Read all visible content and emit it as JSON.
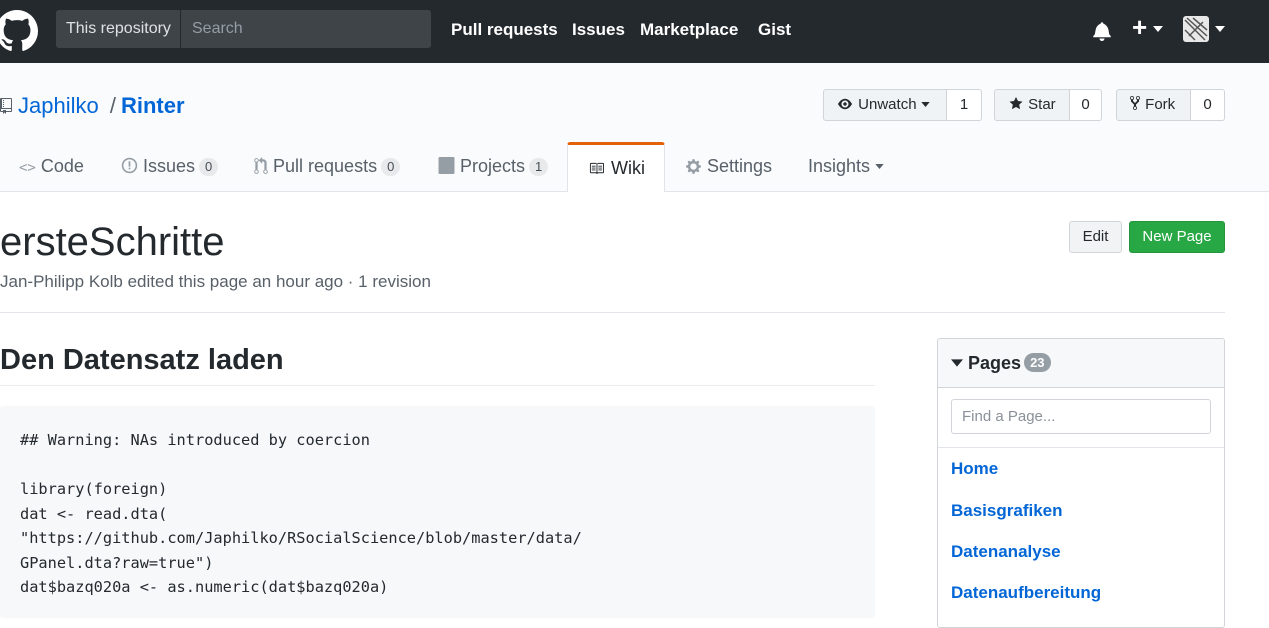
{
  "header": {
    "search_scope": "This repository",
    "search_placeholder": "Search",
    "nav": [
      "Pull requests",
      "Issues",
      "Marketplace",
      "Gist"
    ],
    "plus_label": "+"
  },
  "repo": {
    "owner": "Japhilko",
    "separator": "/",
    "name": "Rinter",
    "watch_label": "Unwatch",
    "watch_count": "1",
    "star_label": "Star",
    "star_count": "0",
    "fork_label": "Fork",
    "fork_count": "0"
  },
  "tabs": [
    {
      "label": "Code",
      "count": null
    },
    {
      "label": "Issues",
      "count": "0"
    },
    {
      "label": "Pull requests",
      "count": "0"
    },
    {
      "label": "Projects",
      "count": "1"
    },
    {
      "label": "Wiki",
      "count": null
    },
    {
      "label": "Settings",
      "count": null
    },
    {
      "label": "Insights",
      "count": null
    }
  ],
  "wiki": {
    "title": "ersteSchritte",
    "meta": "Jan-Philipp Kolb edited this page an hour ago · 1 revision",
    "edit_label": "Edit",
    "new_page_label": "New Page",
    "heading": "Den Datensatz laden",
    "code": "## Warning: NAs introduced by coercion\n\nlibrary(foreign)\ndat <- read.dta(\n\"https://github.com/Japhilko/RSocialScience/blob/master/data/\nGPanel.dta?raw=true\")\ndat$bazq020a <- as.numeric(dat$bazq020a)"
  },
  "sidebar": {
    "title": "Pages",
    "count": "23",
    "filter_placeholder": "Find a Page...",
    "pages": [
      "Home",
      "Basisgrafiken",
      "Datenanalyse",
      "Datenaufbereitung"
    ]
  },
  "colors": {
    "header_bg": "#24292e",
    "link": "#0366d6",
    "primary_btn": "#28a745",
    "tab_accent": "#e36209"
  }
}
